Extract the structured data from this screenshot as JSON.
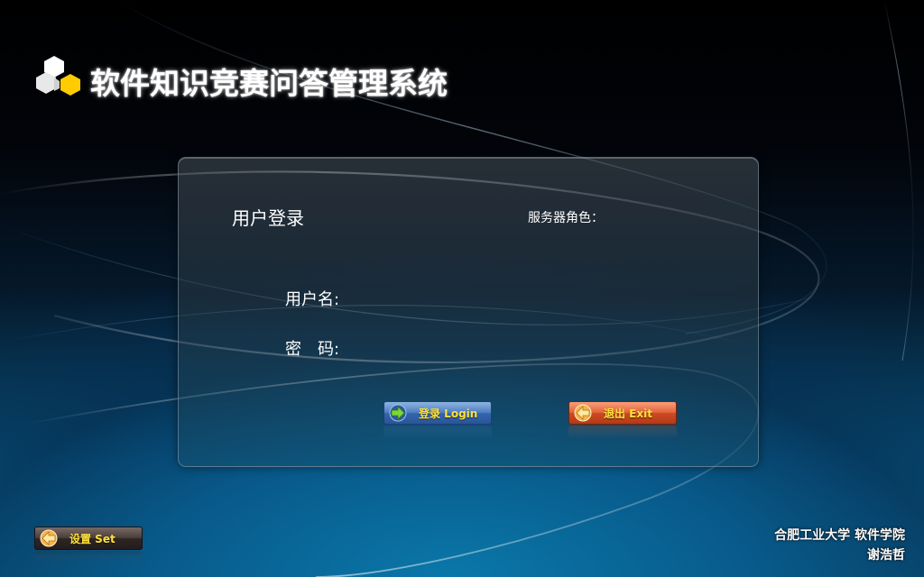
{
  "header": {
    "title": "软件知识竞赛问答管理系统",
    "logo_icon": "hexagon-cubes-logo",
    "accent_color": "#ffcc00"
  },
  "login_panel": {
    "heading": "用户登录",
    "server_role_label": "服务器角色：",
    "server_role_value": "",
    "username_label": "用户名:",
    "username_value": "",
    "password_label": "密　码:",
    "password_value": ""
  },
  "buttons": {
    "login_label": "登录 Login",
    "login_icon": "arrow-right-icon",
    "exit_label": "退出 Exit",
    "exit_icon": "arrow-left-icon",
    "set_label": "设置 Set",
    "set_icon": "arrow-left-icon"
  },
  "footer": {
    "organization": "合肥工业大学 软件学院",
    "author": "谢浩哲"
  }
}
